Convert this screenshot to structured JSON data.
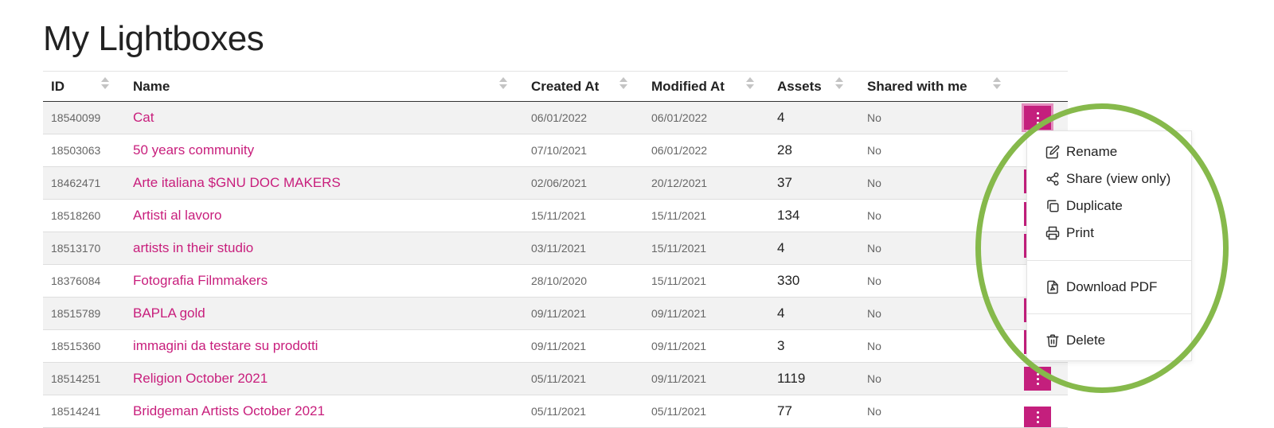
{
  "page": {
    "title": "My Lightboxes"
  },
  "table": {
    "columns": [
      {
        "key": "id",
        "label": "ID"
      },
      {
        "key": "name",
        "label": "Name"
      },
      {
        "key": "created",
        "label": "Created At"
      },
      {
        "key": "modified",
        "label": "Modified At"
      },
      {
        "key": "assets",
        "label": "Assets"
      },
      {
        "key": "shared",
        "label": "Shared with me"
      }
    ],
    "rows": [
      {
        "id": "18540099",
        "name": "Cat",
        "created": "06/01/2022",
        "modified": "06/01/2022",
        "assets": "4",
        "shared": "No"
      },
      {
        "id": "18503063",
        "name": "50 years community",
        "created": "07/10/2021",
        "modified": "06/01/2022",
        "assets": "28",
        "shared": "No"
      },
      {
        "id": "18462471",
        "name": "Arte italiana $GNU DOC MAKERS",
        "created": "02/06/2021",
        "modified": "20/12/2021",
        "assets": "37",
        "shared": "No"
      },
      {
        "id": "18518260",
        "name": "Artisti al lavoro",
        "created": "15/11/2021",
        "modified": "15/11/2021",
        "assets": "134",
        "shared": "No"
      },
      {
        "id": "18513170",
        "name": "artists in their studio",
        "created": "03/11/2021",
        "modified": "15/11/2021",
        "assets": "4",
        "shared": "No"
      },
      {
        "id": "18376084",
        "name": "Fotografia Filmmakers",
        "created": "28/10/2020",
        "modified": "15/11/2021",
        "assets": "330",
        "shared": "No"
      },
      {
        "id": "18515789",
        "name": "BAPLA gold",
        "created": "09/11/2021",
        "modified": "09/11/2021",
        "assets": "4",
        "shared": "No"
      },
      {
        "id": "18515360",
        "name": "immagini da testare su prodotti",
        "created": "09/11/2021",
        "modified": "09/11/2021",
        "assets": "3",
        "shared": "No"
      },
      {
        "id": "18514251",
        "name": "Religion October 2021",
        "created": "05/11/2021",
        "modified": "09/11/2021",
        "assets": "1119",
        "shared": "No"
      },
      {
        "id": "18514241",
        "name": "Bridgeman Artists October 2021",
        "created": "05/11/2021",
        "modified": "05/11/2021",
        "assets": "77",
        "shared": "No"
      }
    ]
  },
  "menu": {
    "rename": "Rename",
    "share": "Share (view only)",
    "duplicate": "Duplicate",
    "print": "Print",
    "download_pdf": "Download PDF",
    "delete": "Delete"
  },
  "colors": {
    "accent": "#c41f7d",
    "link": "#c81e7c",
    "highlight_circle": "#86b94b"
  }
}
